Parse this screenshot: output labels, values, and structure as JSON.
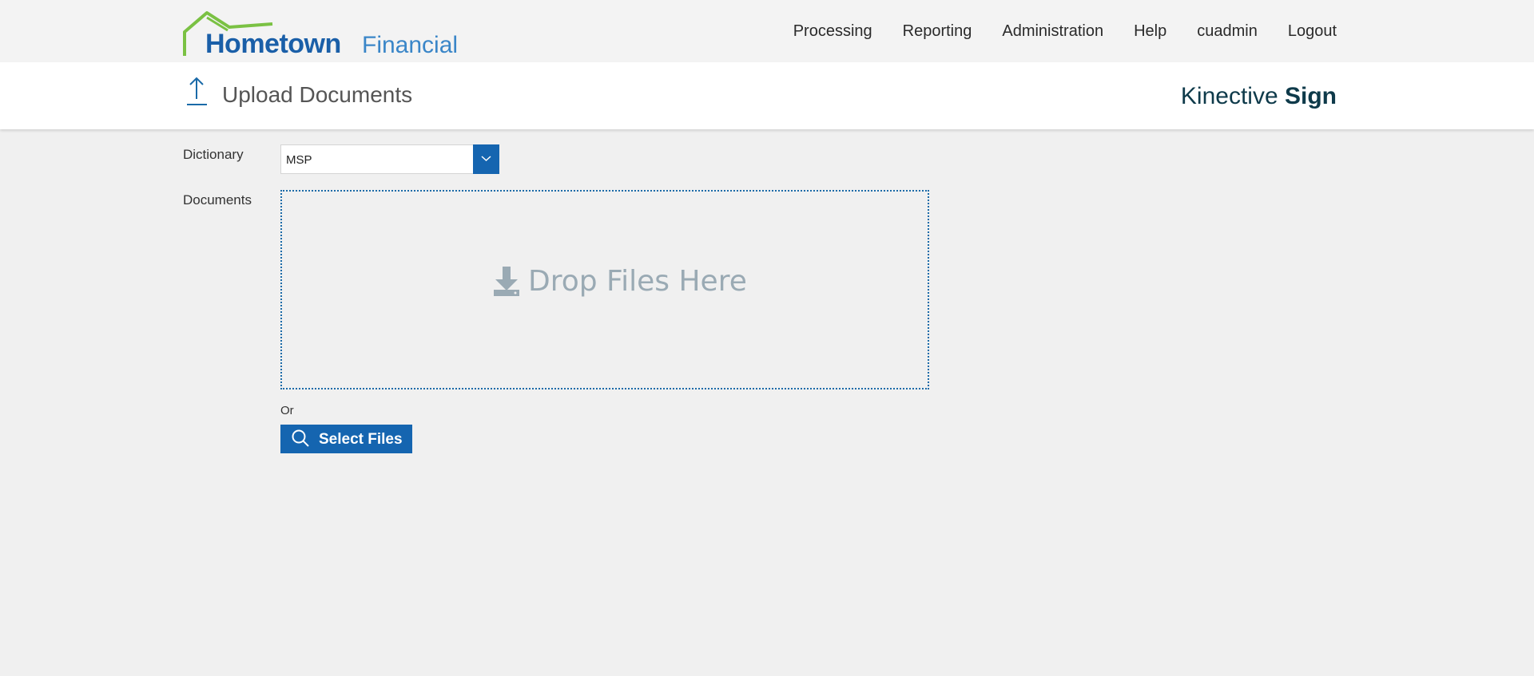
{
  "brand": {
    "main": "Hometown",
    "sub": "Financial",
    "colors": {
      "house": "#7ac143",
      "main": "#1a5fa8",
      "sub": "#3a86c8"
    }
  },
  "nav": {
    "items": [
      "Processing",
      "Reporting",
      "Administration",
      "Help",
      "cuadmin",
      "Logout"
    ]
  },
  "page": {
    "title": "Upload Documents",
    "icon": "upload-arrow-icon",
    "product": {
      "light": "Kinective",
      "bold": "Sign"
    }
  },
  "form": {
    "dictionary_label": "Dictionary",
    "dictionary_value": "MSP",
    "documents_label": "Documents",
    "drop_text": "Drop Files Here",
    "or_text": "Or",
    "select_files_label": "Select Files"
  },
  "colors": {
    "accent": "#1565b0",
    "drop_text": "#9aaab4",
    "background": "#f0f0f0",
    "product": "#0e3a4a"
  }
}
